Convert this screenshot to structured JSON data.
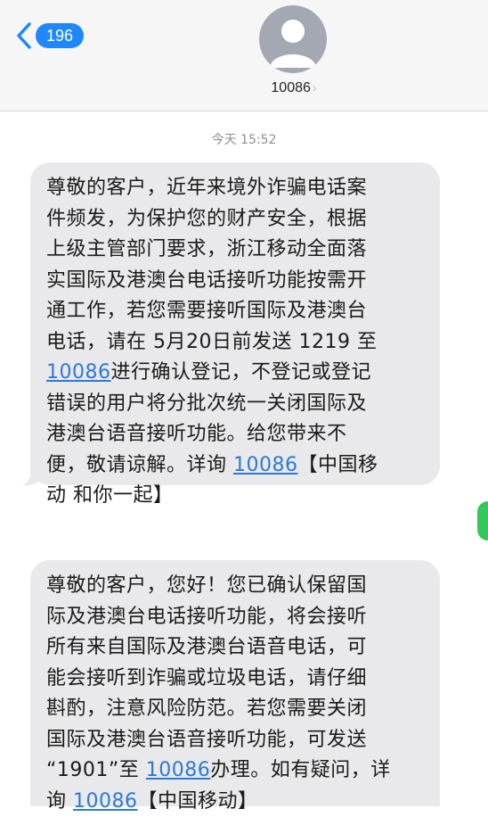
{
  "header": {
    "back_badge": "196",
    "contact_name": "10086",
    "contact_chevron": "›",
    "accent_color": "#1f87ff"
  },
  "thread": {
    "timestamp": "今天 15:52"
  },
  "messages": [
    {
      "lines": [
        [
          {
            "t": "尊敬的客户，近年来境外诈骗电话案"
          }
        ],
        [
          {
            "t": "件频发，为保护您的财产安全，根据"
          }
        ],
        [
          {
            "t": "上级主管部门要求，浙江移动全面落"
          }
        ],
        [
          {
            "t": "实国际及港澳台电话接听功能按需开"
          }
        ],
        [
          {
            "t": "通工作，若您需要接听国际及港澳台"
          }
        ],
        [
          {
            "t": "电话，请在 5月20日前发送 1219 至"
          }
        ],
        [
          {
            "t": "10086",
            "link": true
          },
          {
            "t": "进行确认登记，不登记或登记"
          }
        ],
        [
          {
            "t": "错误的用户将分批次统一关闭国际及"
          }
        ],
        [
          {
            "t": "港澳台语音接听功能。给您带来不"
          }
        ],
        [
          {
            "t": "便，敬请谅解。详询 "
          },
          {
            "t": "10086",
            "link": true
          },
          {
            "t": "【中国移"
          }
        ],
        [
          {
            "t": "动 和你一起】"
          }
        ]
      ]
    },
    {
      "lines": [
        [
          {
            "t": "尊敬的客户，您好！您已确认保留国"
          }
        ],
        [
          {
            "t": "际及港澳台电话接听功能，将会接听"
          }
        ],
        [
          {
            "t": "所有来自国际及港澳台语音电话，可"
          }
        ],
        [
          {
            "t": "能会接听到诈骗或垃圾电话，请仔细"
          }
        ],
        [
          {
            "t": "斟酌，注意风险防范。若您需要关闭"
          }
        ],
        [
          {
            "t": "国际及港澳台语音接听功能，可发送"
          }
        ],
        [
          {
            "t": "“1901”至 "
          },
          {
            "t": "10086",
            "link": true
          },
          {
            "t": "办理。如有疑问，详"
          }
        ],
        [
          {
            "t": "询 "
          },
          {
            "t": "10086",
            "link": true
          },
          {
            "t": "【中国移动】"
          }
        ]
      ]
    }
  ],
  "colors": {
    "bubble_bg": "#e9e9eb",
    "link": "#2c7ad6",
    "header_bg": "#f6f6f6"
  }
}
